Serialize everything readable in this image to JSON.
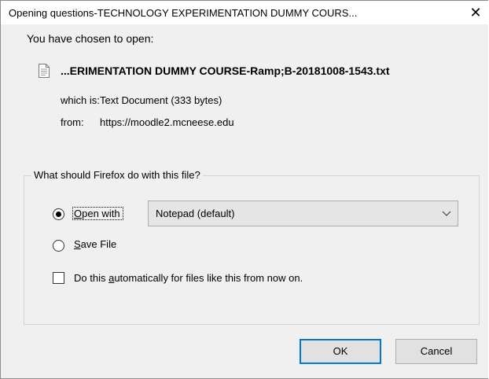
{
  "window": {
    "title": "Opening questions-TECHNOLOGY EXPERIMENTATION DUMMY COURS...",
    "close_glyph": "✕"
  },
  "file": {
    "chosen_label": "You have chosen to open:",
    "name": "...ERIMENTATION DUMMY COURSE-Ramp;B-20181008-1543.txt",
    "which_is_label": "which is:",
    "which_is_value": "Text Document (333 bytes)",
    "from_label": "from:",
    "from_value": "https://moodle2.mcneese.edu",
    "icon": "text-file-icon"
  },
  "action_group": {
    "legend": "What should Firefox do with this file?",
    "open_with": {
      "accesskey": "O",
      "label_rest": "pen with",
      "selected": true,
      "app_value": "Notepad (default)"
    },
    "save_file": {
      "accesskey": "S",
      "label_rest": "ave File",
      "selected": false
    },
    "auto": {
      "label_pre": "Do this ",
      "accesskey": "a",
      "label_post": "utomatically for files like this from now on.",
      "checked": false
    }
  },
  "buttons": {
    "ok_label": "OK",
    "cancel_label": "Cancel"
  }
}
